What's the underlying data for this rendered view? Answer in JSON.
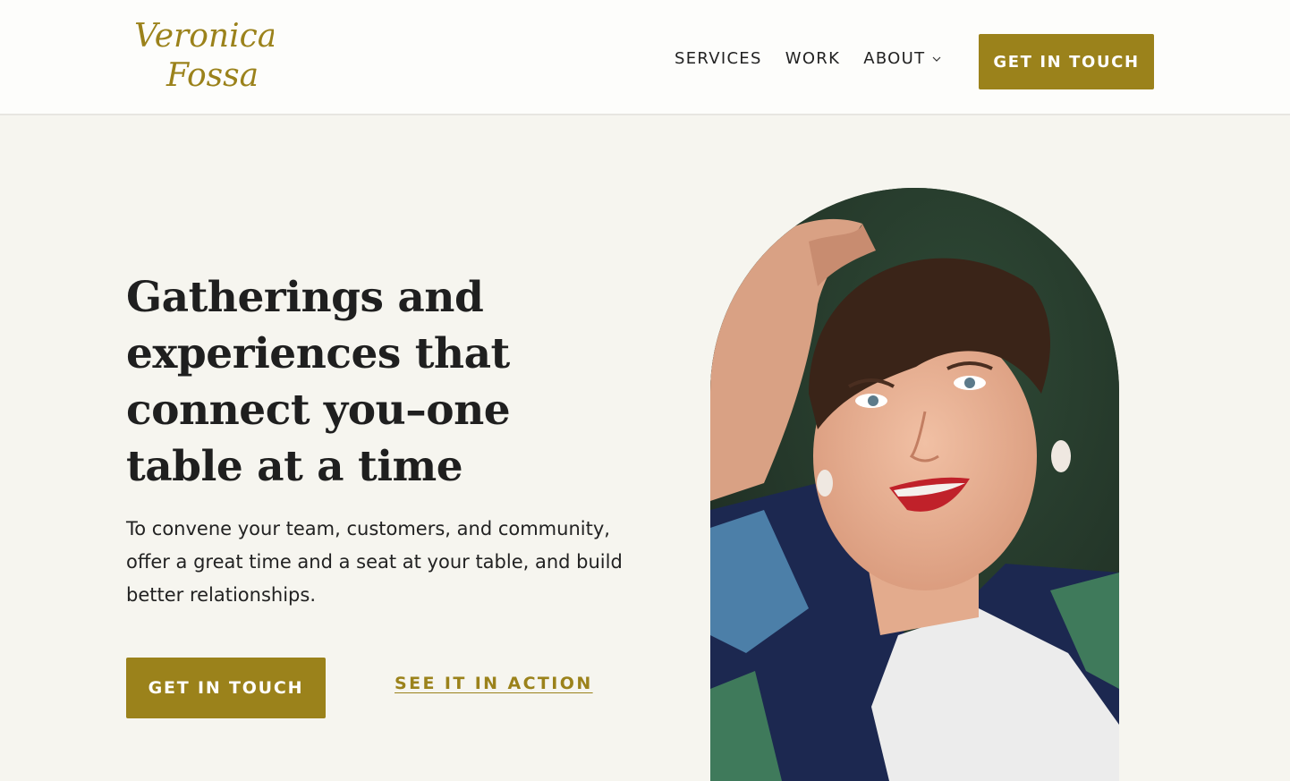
{
  "brand": {
    "logo_line1": "Veronica",
    "logo_line2": "Fossa",
    "accent_color": "#9b821b"
  },
  "nav": {
    "items": [
      {
        "label": "SERVICES"
      },
      {
        "label": "WORK"
      },
      {
        "label": "ABOUT",
        "icon": "chevron-down-icon"
      }
    ],
    "cta_label": "GET IN TOUCH"
  },
  "hero": {
    "title": "Gatherings and experiences that connect you–one table at a time",
    "text": "To convene your team, customers, and community, offer a great time and a seat at your table, and build better relationships.",
    "primary_cta": "GET IN TOUCH",
    "secondary_cta": "SEE IT IN ACTION"
  }
}
